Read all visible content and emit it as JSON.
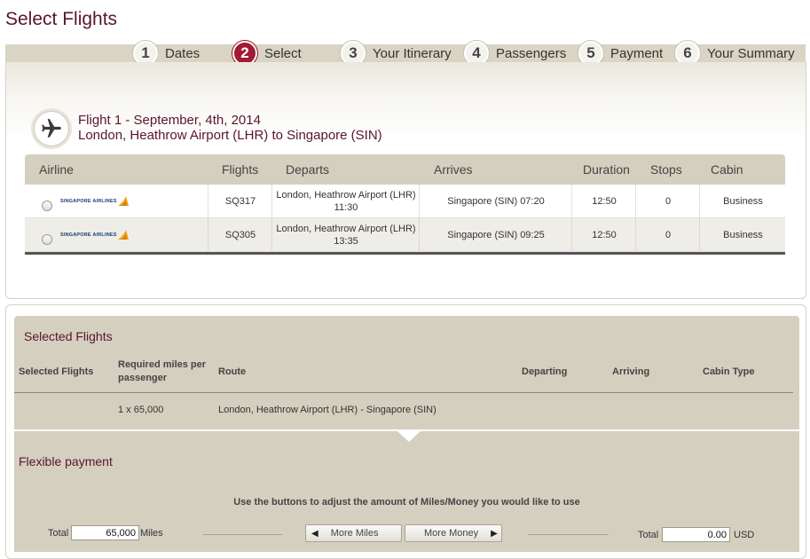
{
  "page_title": "Select Flights",
  "steps": [
    {
      "num": "1",
      "label": "Dates"
    },
    {
      "num": "2",
      "label": "Select"
    },
    {
      "num": "3",
      "label": "Your Itinerary"
    },
    {
      "num": "4",
      "label": "Passengers"
    },
    {
      "num": "5",
      "label": "Payment"
    },
    {
      "num": "6",
      "label": "Your Summary"
    }
  ],
  "active_step": 2,
  "flight": {
    "title_line1": "Flight 1 - September, 4th, 2014",
    "title_line2": "London, Heathrow Airport (LHR) to Singapore (SIN)",
    "columns": [
      "Airline",
      "Flights",
      "Departs",
      "Arrives",
      "Duration",
      "Stops",
      "Cabin"
    ],
    "rows": [
      {
        "airline": "SINGAPORE AIRLINES",
        "flight": "SQ317",
        "departs_place": "London, Heathrow Airport (LHR)",
        "departs_time": "11:30",
        "arrives": "Singapore (SIN) 07:20",
        "duration": "12:50",
        "stops": "0",
        "cabin": "Business"
      },
      {
        "airline": "SINGAPORE AIRLINES",
        "flight": "SQ305",
        "departs_place": "London, Heathrow Airport (LHR)",
        "departs_time": "13:35",
        "arrives": "Singapore (SIN) 09:25",
        "duration": "12:50",
        "stops": "0",
        "cabin": "Business"
      }
    ]
  },
  "selected": {
    "title": "Selected Flights",
    "col_selected": "Selected Flights",
    "col_miles_1": "Required miles per",
    "col_miles_2": "passenger",
    "col_route": "Route",
    "col_departing": "Departing",
    "col_arriving": "Arriving",
    "col_cabin": "Cabin Type",
    "miles_value": "1 x 65,000",
    "route_value": "London, Heathrow Airport (LHR) - Singapore (SIN)"
  },
  "flexible": {
    "title": "Flexible payment",
    "instruction": "Use the buttons to adjust the amount of Miles/Money you would like to use",
    "total_label_left": "Total",
    "miles_value": "65,000",
    "miles_unit": "Miles",
    "more_miles_label": "More Miles",
    "more_money_label": "More Money",
    "total_label_right": "Total",
    "money_value": "0.00",
    "currency": "USD"
  },
  "colors": {
    "brand": "#5a1530",
    "active_step": "#a31a35",
    "panel": "#d4cfbf"
  }
}
